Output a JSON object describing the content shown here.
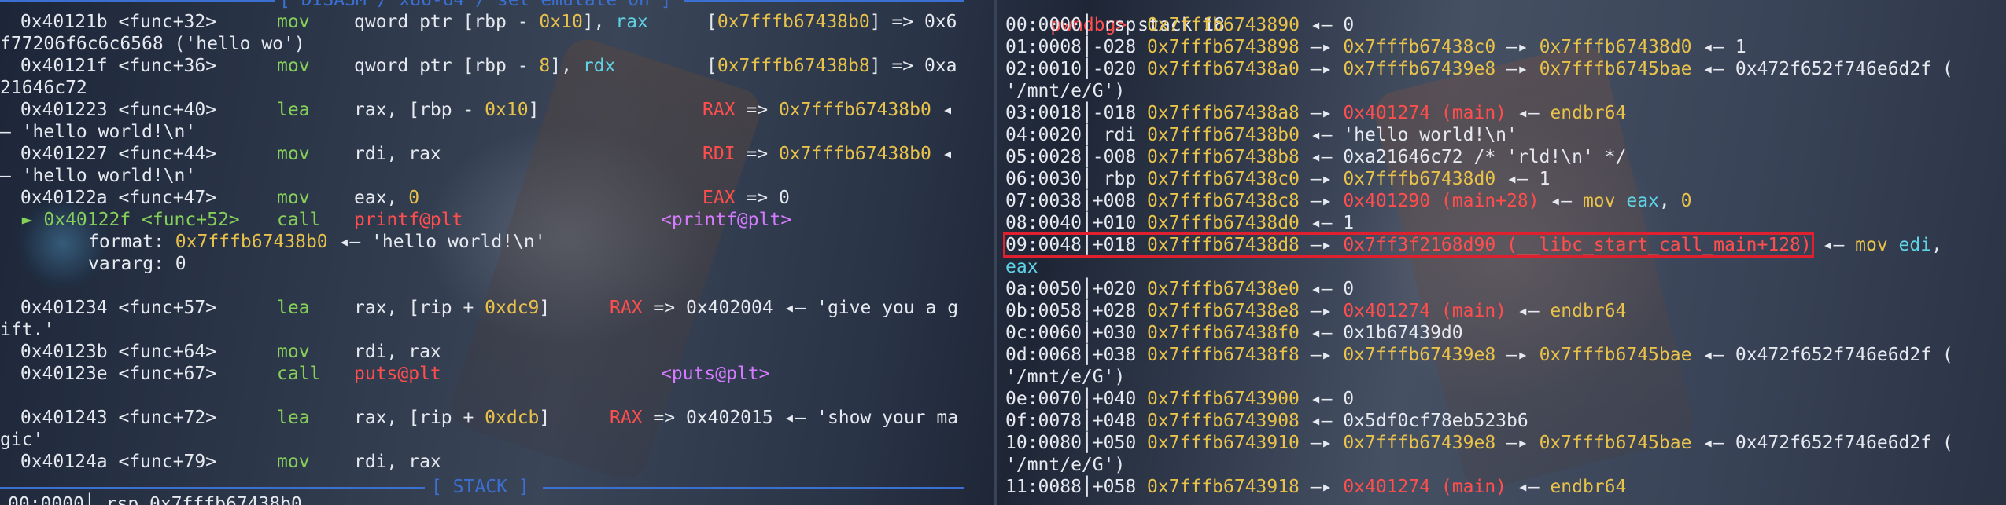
{
  "left": {
    "title_top": "[ DISASM / x86-64 / set emulate on ]",
    "title_bottom": "[ STACK ]",
    "disasm": [
      {
        "addr": "0x40121b",
        "func": "<func+32>",
        "mn": "mov",
        "op1": "qword ptr [rbp - ",
        "op1n": "0x10",
        "op1e": "], ",
        "op2": "rax",
        "ann_pre": "[",
        "ann_addr": "0x7fffb67438b0",
        "ann_post": "] => 0x6",
        "wrap": "f77206f6c6c6568 ('hello wo')"
      },
      {
        "addr": "0x40121f",
        "func": "<func+36>",
        "mn": "mov",
        "op1": "qword ptr [rbp - ",
        "op1n": "8",
        "op1e": "], ",
        "op2": "rdx",
        "ann_pre": "[",
        "ann_addr": "0x7fffb67438b8",
        "ann_post": "] => 0xa",
        "wrap": "21646c72"
      },
      {
        "addr": "0x401223",
        "func": "<func+40>",
        "mn": "lea",
        "op1": "rax, [rbp - ",
        "op1n": "0x10",
        "op1e": "]",
        "op2": "",
        "ann_reg": "RAX",
        "ann_arrow": " => ",
        "ann_addr": "0x7fffb67438b0",
        "ann_post": " ◂",
        "wrap": "— 'hello world!\\n'"
      },
      {
        "addr": "0x401227",
        "func": "<func+44>",
        "mn": "mov",
        "op1": "rdi, rax",
        "op1n": "",
        "op1e": "",
        "op2": "",
        "ann_reg": "RDI",
        "ann_arrow": " => ",
        "ann_addr": "0x7fffb67438b0",
        "ann_post": " ◂",
        "wrap": "— 'hello world!\\n'"
      },
      {
        "addr": "0x40122a",
        "func": "<func+47>",
        "mn": "mov",
        "op1": "eax, ",
        "op1n": "0",
        "op1e": "",
        "op2": "",
        "ann_reg": "EAX",
        "ann_arrow": " => ",
        "ann_val": "0"
      },
      {
        "addr": "0x40122f",
        "func": "<func+52>",
        "mn": "call",
        "target": "printf@plt",
        "ann_target": "<printf@plt>",
        "current": true
      },
      {
        "addr": "0x401234",
        "func": "<func+57>",
        "mn": "lea",
        "op1": "rax, [rip + ",
        "op1n": "0xdc9",
        "op1e": "]",
        "ann_reg": "RAX",
        "ann_arrow": " => ",
        "ann_val": "0x402004 ◂— 'give you a g",
        "wrap": "ift.'"
      },
      {
        "addr": "0x40123b",
        "func": "<func+64>",
        "mn": "mov",
        "op1": "rdi, rax",
        "op1n": "",
        "op1e": ""
      },
      {
        "addr": "0x40123e",
        "func": "<func+67>",
        "mn": "call",
        "target": "puts@plt",
        "ann_target": "<puts@plt>"
      },
      {
        "addr": "0x401243",
        "func": "<func+72>",
        "mn": "lea",
        "op1": "rax, [rip + ",
        "op1n": "0xdcb",
        "op1e": "]",
        "ann_reg": "RAX",
        "ann_arrow": " => ",
        "ann_val": "0x402015 ◂— 'show your ma",
        "wrap": "gic'"
      },
      {
        "addr": "0x40124a",
        "func": "<func+79>",
        "mn": "mov",
        "op1": "rdi, rax",
        "op1n": "",
        "op1e": ""
      }
    ],
    "printf_args": [
      {
        "name": "format",
        "sep": ": ",
        "addr": "0x7fffb67438b0",
        "rest": " ◂— 'hello world!\\n'"
      },
      {
        "name": "vararg",
        "sep": ": ",
        "val": "0"
      }
    ],
    "partial_bottom": "00:0000│ rsp 0x7fffb67438b0"
  },
  "right": {
    "prompt": "pwndbg>",
    "command": " stack 18",
    "rows": [
      {
        "idx": "00:0000",
        "off": "",
        "reg": "rsp",
        "a1": "0x7fffb6743890",
        "tail": [
          {
            "t": " ◂— ",
            "c": "w"
          },
          {
            "t": "0",
            "c": "w"
          }
        ]
      },
      {
        "idx": "01:0008",
        "off": "-028",
        "reg": "",
        "a1": "0x7fffb6743898",
        "tail": [
          {
            "t": " —▸ ",
            "c": "w"
          },
          {
            "t": "0x7fffb67438c0",
            "c": "y"
          },
          {
            "t": " —▸ ",
            "c": "w"
          },
          {
            "t": "0x7fffb67438d0",
            "c": "y"
          },
          {
            "t": " ◂— 1",
            "c": "w"
          }
        ]
      },
      {
        "idx": "02:0010",
        "off": "-020",
        "reg": "",
        "a1": "0x7fffb67438a0",
        "tail": [
          {
            "t": " —▸ ",
            "c": "w"
          },
          {
            "t": "0x7fffb67439e8",
            "c": "y"
          },
          {
            "t": " —▸ ",
            "c": "w"
          },
          {
            "t": "0x7fffb6745bae",
            "c": "y"
          },
          {
            "t": " ◂— 0x472f652f746e6d2f (",
            "c": "w"
          }
        ],
        "wrap": "'/mnt/e/G')"
      },
      {
        "idx": "03:0018",
        "off": "-018",
        "reg": "",
        "a1": "0x7fffb67438a8",
        "tail": [
          {
            "t": " —▸ ",
            "c": "w"
          },
          {
            "t": "0x401274 (main)",
            "c": "r"
          },
          {
            "t": " ◂— ",
            "c": "w"
          },
          {
            "t": "endbr64",
            "c": "y"
          }
        ]
      },
      {
        "idx": "04:0020",
        "off": "",
        "reg": "rdi",
        "a1": "0x7fffb67438b0",
        "tail": [
          {
            "t": " ◂— 'hello world!\\n'",
            "c": "w"
          }
        ]
      },
      {
        "idx": "05:0028",
        "off": "-008",
        "reg": "",
        "a1": "0x7fffb67438b8",
        "tail": [
          {
            "t": " ◂— 0xa21646c72 /* 'rld!\\n' */",
            "c": "w"
          }
        ]
      },
      {
        "idx": "06:0030",
        "off": "",
        "reg": "rbp",
        "a1": "0x7fffb67438c0",
        "tail": [
          {
            "t": " —▸ ",
            "c": "w"
          },
          {
            "t": "0x7fffb67438d0",
            "c": "y"
          },
          {
            "t": " ◂— 1",
            "c": "w"
          }
        ]
      },
      {
        "idx": "07:0038",
        "off": "+008",
        "reg": "",
        "a1": "0x7fffb67438c8",
        "tail": [
          {
            "t": " —▸ ",
            "c": "w"
          },
          {
            "t": "0x401290 (main+28)",
            "c": "r"
          },
          {
            "t": " ◂— ",
            "c": "w"
          },
          {
            "t": "mov ",
            "c": "y"
          },
          {
            "t": "eax",
            "c": "c"
          },
          {
            "t": ", ",
            "c": "w"
          },
          {
            "t": "0",
            "c": "y"
          }
        ]
      },
      {
        "idx": "08:0040",
        "off": "+010",
        "reg": "",
        "a1": "0x7fffb67438d0",
        "tail": [
          {
            "t": " ◂— 1",
            "c": "w"
          }
        ]
      },
      {
        "idx": "09:0048",
        "off": "+018",
        "reg": "",
        "a1": "0x7fffb67438d8",
        "tail": [
          {
            "t": " —▸ ",
            "c": "w"
          },
          {
            "t": "0x7ff3f2168d90 (__libc_start_call_main+128)",
            "c": "r"
          },
          {
            "t": " ◂— ",
            "c": "w"
          },
          {
            "t": "mov ",
            "c": "y"
          },
          {
            "t": "edi",
            "c": "c"
          },
          {
            "t": ",",
            "c": "w"
          }
        ],
        "wrap": "eax",
        "wrapc": "c",
        "highlight": true
      },
      {
        "idx": "0a:0050",
        "off": "+020",
        "reg": "",
        "a1": "0x7fffb67438e0",
        "tail": [
          {
            "t": " ◂— 0",
            "c": "w"
          }
        ]
      },
      {
        "idx": "0b:0058",
        "off": "+028",
        "reg": "",
        "a1": "0x7fffb67438e8",
        "tail": [
          {
            "t": " —▸ ",
            "c": "w"
          },
          {
            "t": "0x401274 (main)",
            "c": "r"
          },
          {
            "t": " ◂— ",
            "c": "w"
          },
          {
            "t": "endbr64",
            "c": "y"
          }
        ]
      },
      {
        "idx": "0c:0060",
        "off": "+030",
        "reg": "",
        "a1": "0x7fffb67438f0",
        "tail": [
          {
            "t": " ◂— 0x1b67439d0",
            "c": "w"
          }
        ]
      },
      {
        "idx": "0d:0068",
        "off": "+038",
        "reg": "",
        "a1": "0x7fffb67438f8",
        "tail": [
          {
            "t": " —▸ ",
            "c": "w"
          },
          {
            "t": "0x7fffb67439e8",
            "c": "y"
          },
          {
            "t": " —▸ ",
            "c": "w"
          },
          {
            "t": "0x7fffb6745bae",
            "c": "y"
          },
          {
            "t": " ◂— 0x472f652f746e6d2f (",
            "c": "w"
          }
        ],
        "wrap": "'/mnt/e/G')"
      },
      {
        "idx": "0e:0070",
        "off": "+040",
        "reg": "",
        "a1": "0x7fffb6743900",
        "tail": [
          {
            "t": " ◂— 0",
            "c": "w"
          }
        ]
      },
      {
        "idx": "0f:0078",
        "off": "+048",
        "reg": "",
        "a1": "0x7fffb6743908",
        "tail": [
          {
            "t": " ◂— 0x5df0cf78eb523b6",
            "c": "w"
          }
        ]
      },
      {
        "idx": "10:0080",
        "off": "+050",
        "reg": "",
        "a1": "0x7fffb6743910",
        "tail": [
          {
            "t": " —▸ ",
            "c": "w"
          },
          {
            "t": "0x7fffb67439e8",
            "c": "y"
          },
          {
            "t": " —▸ ",
            "c": "w"
          },
          {
            "t": "0x7fffb6745bae",
            "c": "y"
          },
          {
            "t": " ◂— 0x472f652f746e6d2f (",
            "c": "w"
          }
        ],
        "wrap": "'/mnt/e/G')"
      },
      {
        "idx": "11:0088",
        "off": "+058",
        "reg": "",
        "a1": "0x7fffb6743918",
        "tail": [
          {
            "t": " —▸ ",
            "c": "w"
          },
          {
            "t": "0x401274 (main)",
            "c": "r"
          },
          {
            "t": " ◂— ",
            "c": "w"
          },
          {
            "t": "endbr64",
            "c": "y"
          }
        ]
      }
    ]
  },
  "colors": {
    "address": "#e8c24a",
    "code": "#ff4e4e",
    "mnemonic": "#86d05a",
    "register": "#5fd3e6",
    "plt": "#ff4e4e",
    "rule": "#3b6fd1",
    "highlight": "#e01f2f"
  }
}
